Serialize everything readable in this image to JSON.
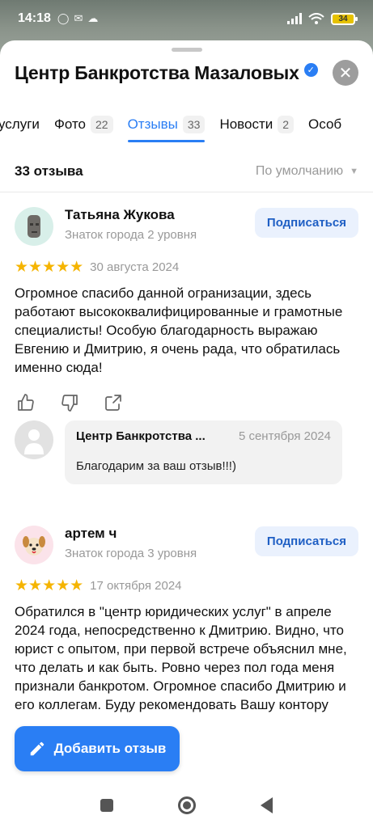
{
  "status_bar": {
    "time": "14:18",
    "battery": "34",
    "icons": [
      "whatsapp-icon",
      "mail-icon",
      "cloud-icon",
      "signal-icon",
      "wifi-icon",
      "battery-icon"
    ]
  },
  "header": {
    "title": "Центр Банкротства Мазаловых",
    "verified": "✓",
    "close": "✕"
  },
  "tabs": [
    {
      "label": "услуги",
      "count": ""
    },
    {
      "label": "Фото",
      "count": "22"
    },
    {
      "label": "Отзывы",
      "count": "33",
      "active": true
    },
    {
      "label": "Новости",
      "count": "2"
    },
    {
      "label": "Особ",
      "count": ""
    }
  ],
  "reviews_header": {
    "count": "33 отзыва",
    "sort": "По умолчанию",
    "sort_arrow": "▼"
  },
  "reviews": [
    {
      "name": "Татьяна Жукова",
      "level": "Знаток города 2 уровня",
      "subscribe": "Подписаться",
      "stars": "★★★★★",
      "rating": 5,
      "date": "30 августа 2024",
      "text": "Огромное спасибо данной огранизации, здесь работают высококвалифицированные и грамотные специалисты! Особую благодарность выражаю Евгению и Дмитрию, я очень рада, что обратилась именно сюда!",
      "reply": {
        "org": "Центр Банкротства ...",
        "date": "5 сентября 2024",
        "text": "Благодарим за ваш отзыв!!!)"
      }
    },
    {
      "name": "артем ч",
      "level": "Знаток города 3 уровня",
      "subscribe": "Подписаться",
      "stars": "★★★★★",
      "rating": 5,
      "date": "17 октября 2024",
      "text": "Обратился в \"центр юридических услуг\" в апреле 2024 года, непосредственно к Дмитрию. Видно, что юрист с опытом, при первой встрече объяснил мне, что делать и как быть. Ровно через пол года меня признали банкротом. Огромное спасибо Дмитрию и его коллегам. Буду рекомендовать Вашу контору друзьям"
    }
  ],
  "add_review": "Добавить отзыв",
  "colors": {
    "accent": "#2a7ef4",
    "star": "#f5b400",
    "subscribe_bg": "#eaf1fd"
  }
}
